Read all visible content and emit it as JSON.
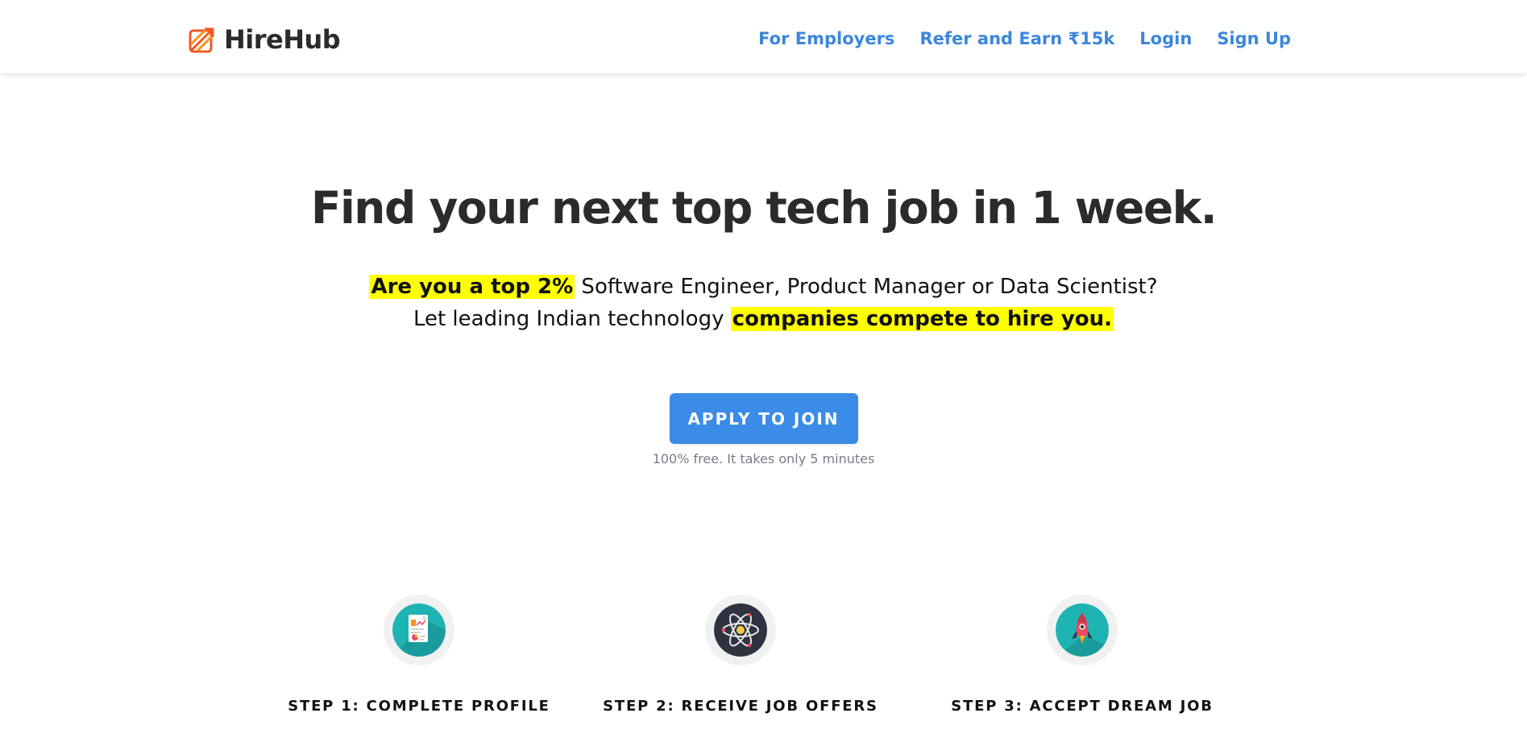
{
  "brand": {
    "name": "HireHub",
    "logo_color": "#f15a24"
  },
  "nav": {
    "links": [
      "For Employers",
      "Refer and Earn ₹15k",
      "Login",
      "Sign Up"
    ],
    "color": "#3c86dc"
  },
  "hero": {
    "title": "Find your next top tech job in 1 week.",
    "line1_highlight": "Are you a top 2%",
    "line1_rest": " Software Engineer, Product Manager or Data Scientist?",
    "line2_rest": "Let leading Indian technology ",
    "line2_highlight": "companies compete to hire you.",
    "highlight_color": "#ffff00"
  },
  "cta": {
    "label": "APPLY TO JOIN",
    "note": "100% free. It takes only 5 minutes",
    "color": "#3a8ce6"
  },
  "steps": [
    {
      "label": "STEP 1: COMPLETE PROFILE",
      "icon": "profile-document-icon"
    },
    {
      "label": "STEP 2: RECEIVE JOB OFFERS",
      "icon": "atom-icon"
    },
    {
      "label": "STEP 3: ACCEPT DREAM JOB",
      "icon": "rocket-icon"
    }
  ]
}
